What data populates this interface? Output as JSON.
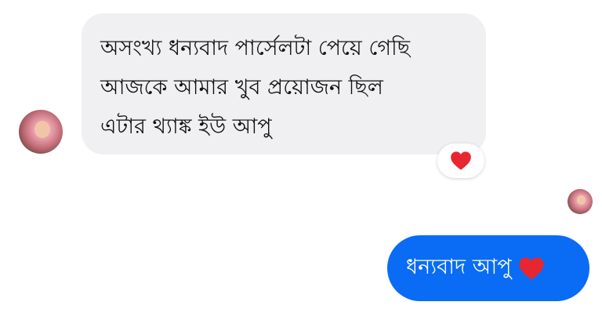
{
  "received_message": {
    "lines": [
      "অসংখ্য ধন্যবাদ পার্সেলটা পেয়ে গেছি",
      "আজকে আমার খুব প্রয়োজন ছিল",
      "এটার থ্যাঙ্ক ইউ আপু"
    ],
    "bubble_color": "#f0f0f2",
    "reaction_icon": "heart-icon",
    "reaction_color": "#e8262f"
  },
  "sent_message": {
    "text": "ধন্যবাদ আপু",
    "trailing_icon": "heart-icon",
    "bubble_color": "#0a6cf5",
    "text_color": "#ffffff"
  },
  "sender_avatar": {
    "icon": "avatar"
  },
  "seen_avatar": {
    "icon": "avatar"
  }
}
